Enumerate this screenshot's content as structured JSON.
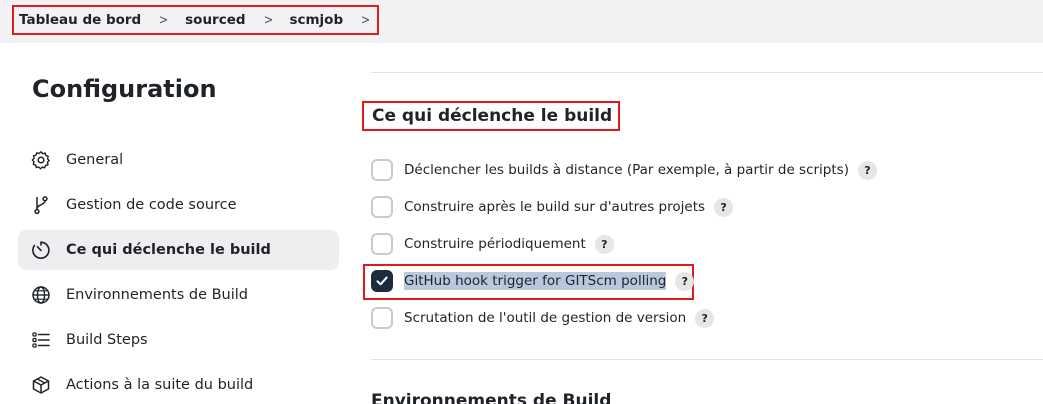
{
  "breadcrumb": {
    "items": [
      "Tableau de bord",
      "sourced",
      "scmjob"
    ]
  },
  "page_title": "Configuration",
  "sidebar": {
    "items": [
      {
        "label": "General",
        "icon": "gear-icon",
        "active": false
      },
      {
        "label": "Gestion de code source",
        "icon": "git-branch-icon",
        "active": false
      },
      {
        "label": "Ce qui déclenche le build",
        "icon": "timer-icon",
        "active": true
      },
      {
        "label": "Environnements de Build",
        "icon": "globe-icon",
        "active": false
      },
      {
        "label": "Build Steps",
        "icon": "list-icon",
        "active": false
      },
      {
        "label": "Actions à la suite du build",
        "icon": "package-icon",
        "active": false
      }
    ]
  },
  "triggers": {
    "title": "Ce qui déclenche le build",
    "options": [
      {
        "label": "Déclencher les builds à distance (Par exemple, à partir de scripts)",
        "checked": false,
        "help": "?"
      },
      {
        "label": "Construire après le build sur d'autres projets",
        "checked": false,
        "help": "?"
      },
      {
        "label": "Construire périodiquement",
        "checked": false,
        "help": "?"
      },
      {
        "label": "GitHub hook trigger for GITScm polling",
        "checked": true,
        "help": "?"
      },
      {
        "label": "Scrutation de l'outil de gestion de version",
        "checked": false,
        "help": "?"
      }
    ]
  },
  "next_section": {
    "title": "Environnements de Build"
  },
  "colors": {
    "highlight_border": "#e11b1b",
    "checkbox_checked": "#1d2b3e",
    "selection": "#b8c9de",
    "active_item_bg": "#eeeef1"
  }
}
